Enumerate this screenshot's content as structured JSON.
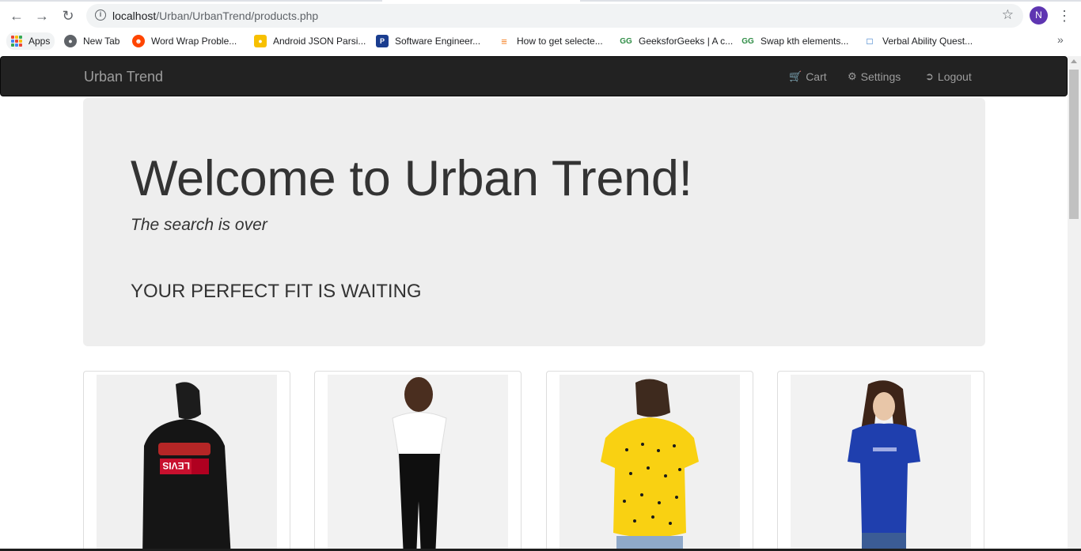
{
  "browser": {
    "url_host": "localhost",
    "url_path": "/Urban/UrbanTrend/products.php",
    "profile_initial": "N",
    "bookmarks": [
      {
        "label": "Apps",
        "icon": "apps-grid-icon"
      },
      {
        "label": "New Tab",
        "icon": "globe-icon"
      },
      {
        "label": "Word Wrap Proble...",
        "icon": "reddit-icon"
      },
      {
        "label": "Android JSON Parsi...",
        "icon": "bookmark-yellow-icon"
      },
      {
        "label": "Software Engineer...",
        "icon": "p-logo-icon"
      },
      {
        "label": "How to get selecte...",
        "icon": "stackoverflow-icon"
      },
      {
        "label": "GeeksforGeeks | A c...",
        "icon": "gfg-icon"
      },
      {
        "label": "Swap kth elements...",
        "icon": "gfg-icon"
      },
      {
        "label": "Verbal Ability Quest...",
        "icon": "indiabix-icon"
      }
    ]
  },
  "navbar": {
    "brand": "Urban Trend",
    "links": [
      {
        "label": "Cart",
        "icon": "cart-icon"
      },
      {
        "label": "Settings",
        "icon": "gear-icon"
      },
      {
        "label": "Logout",
        "icon": "logout-icon"
      }
    ]
  },
  "hero": {
    "title": "Welcome to Urban Trend!",
    "tagline": "The search is over",
    "subtitle": "YOUR PERFECT FIT IS WAITING"
  },
  "products": [
    {
      "image": "black-hoodie-back-view"
    },
    {
      "image": "white-shirt-black-jeans"
    },
    {
      "image": "yellow-printed-tee-back-view"
    },
    {
      "image": "blue-logo-tee"
    }
  ],
  "colors": {
    "navbar_bg": "#222222",
    "nav_text": "#9d9d9d",
    "jumbotron_bg": "#eeeeee",
    "profile_bg": "#5e35b1"
  }
}
